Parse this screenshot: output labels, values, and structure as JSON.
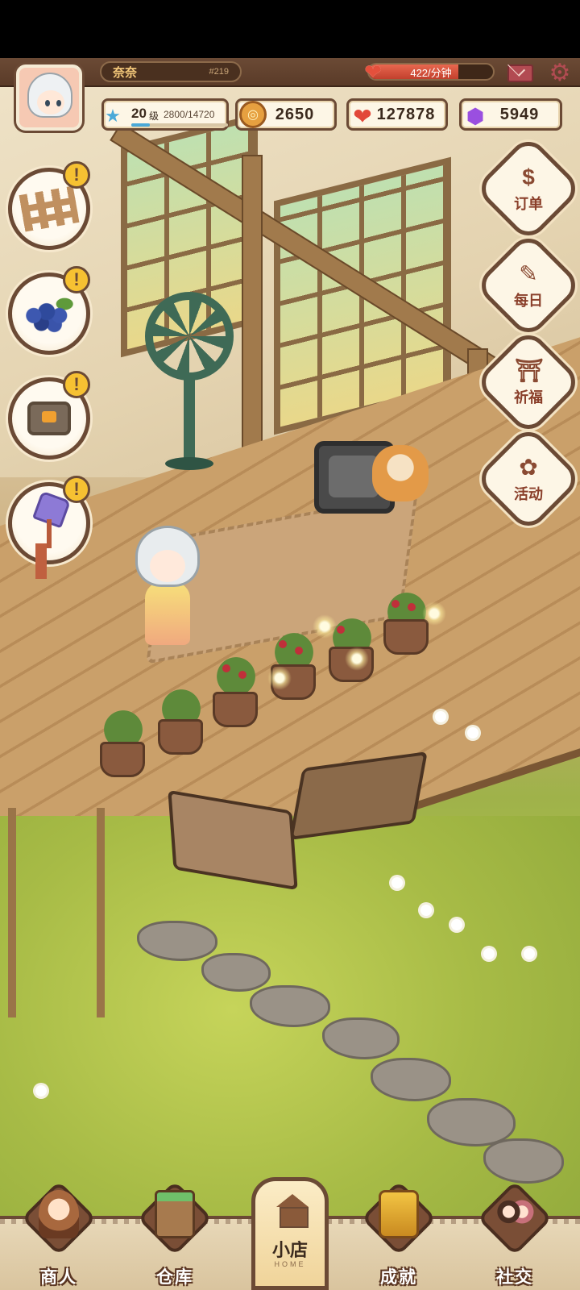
{
  "player": {
    "name": "奈奈",
    "id": "#219",
    "level": "20",
    "level_unit": "级",
    "xp": "2800/14720",
    "xp_progress": 0.19
  },
  "income": {
    "rate": "422/分钟",
    "rate_progress": 0.72
  },
  "resources": {
    "coins": "2650",
    "hearts": "127878",
    "gems": "5949"
  },
  "icons": {
    "level": "star-icon",
    "coins": "coin-icon",
    "hearts": "heart-icon",
    "gems": "gem-icon",
    "mail": "mail-icon",
    "settings": "gear-icon"
  },
  "left_buttons": [
    {
      "name": "fence",
      "alert": "!"
    },
    {
      "name": "blueberry",
      "alert": "!"
    },
    {
      "name": "tv",
      "alert": "!"
    },
    {
      "name": "lamp",
      "alert": "!"
    }
  ],
  "right_buttons": [
    {
      "label": "订单",
      "icon": "$"
    },
    {
      "label": "每日",
      "icon": "✎"
    },
    {
      "label": "祈福",
      "icon": "⛩"
    },
    {
      "label": "活动",
      "icon": "✿"
    }
  ],
  "bottom_nav": {
    "merchant": "商人",
    "warehouse": "仓库",
    "home": "小店",
    "home_sub": "HOME",
    "achievement": "成就",
    "social": "社交"
  },
  "colors": {
    "frame_brown": "#6b4a35",
    "alert_yellow": "#f6c132",
    "label_red": "#8a3f2a",
    "rate_red": "#c2402d",
    "xp_blue": "#4aa9d8"
  }
}
